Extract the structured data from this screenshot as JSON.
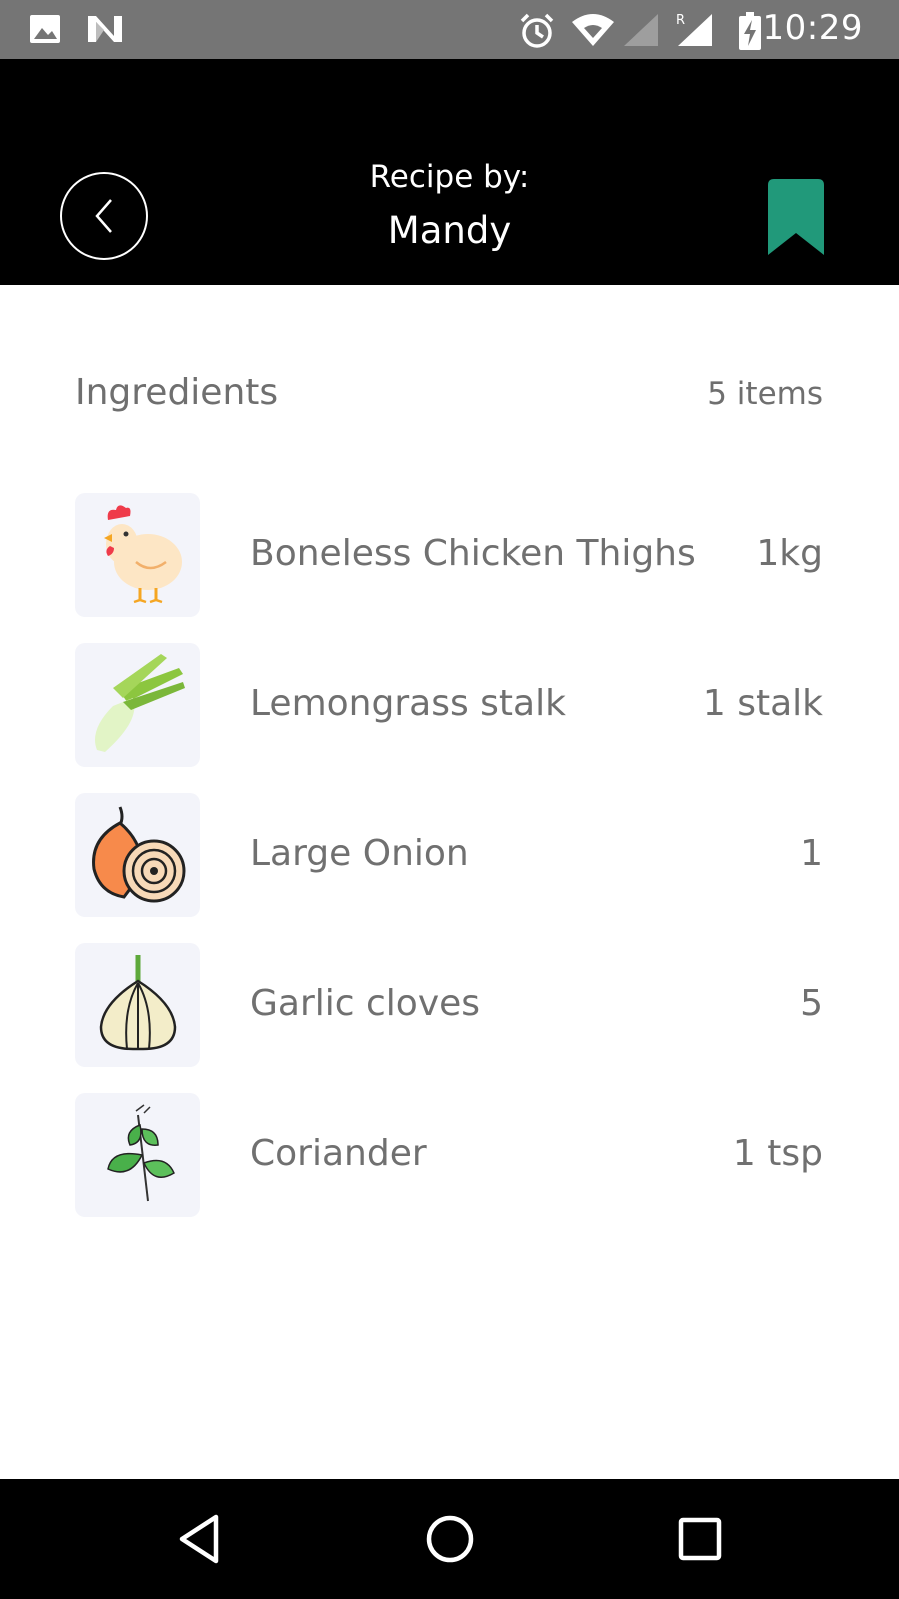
{
  "status_bar": {
    "time": "10:29",
    "icons": [
      "image-icon",
      "n-icon",
      "alarm-icon",
      "wifi-icon",
      "signal-icon",
      "roaming-signal-icon",
      "battery-charging-icon"
    ]
  },
  "header": {
    "subtitle": "Recipe by:",
    "author": "Mandy",
    "back_icon": "chevron-left-icon",
    "bookmark_icon": "bookmark-icon",
    "bookmark_color": "#21997a"
  },
  "ingredients": {
    "title": "Ingredients",
    "count": "5 items",
    "items": [
      {
        "name": "Boneless Chicken Thighs",
        "qty": "1kg",
        "icon": "chicken-icon"
      },
      {
        "name": "Lemongrass stalk",
        "qty": "1 stalk",
        "icon": "lemongrass-icon"
      },
      {
        "name": "Large Onion",
        "qty": "1",
        "icon": "onion-icon"
      },
      {
        "name": "Garlic cloves",
        "qty": "5",
        "icon": "garlic-icon"
      },
      {
        "name": "Coriander",
        "qty": "1 tsp",
        "icon": "coriander-icon"
      }
    ]
  },
  "nav_bar": {
    "icons": [
      "back-triangle-icon",
      "home-circle-icon",
      "recents-square-icon"
    ]
  }
}
